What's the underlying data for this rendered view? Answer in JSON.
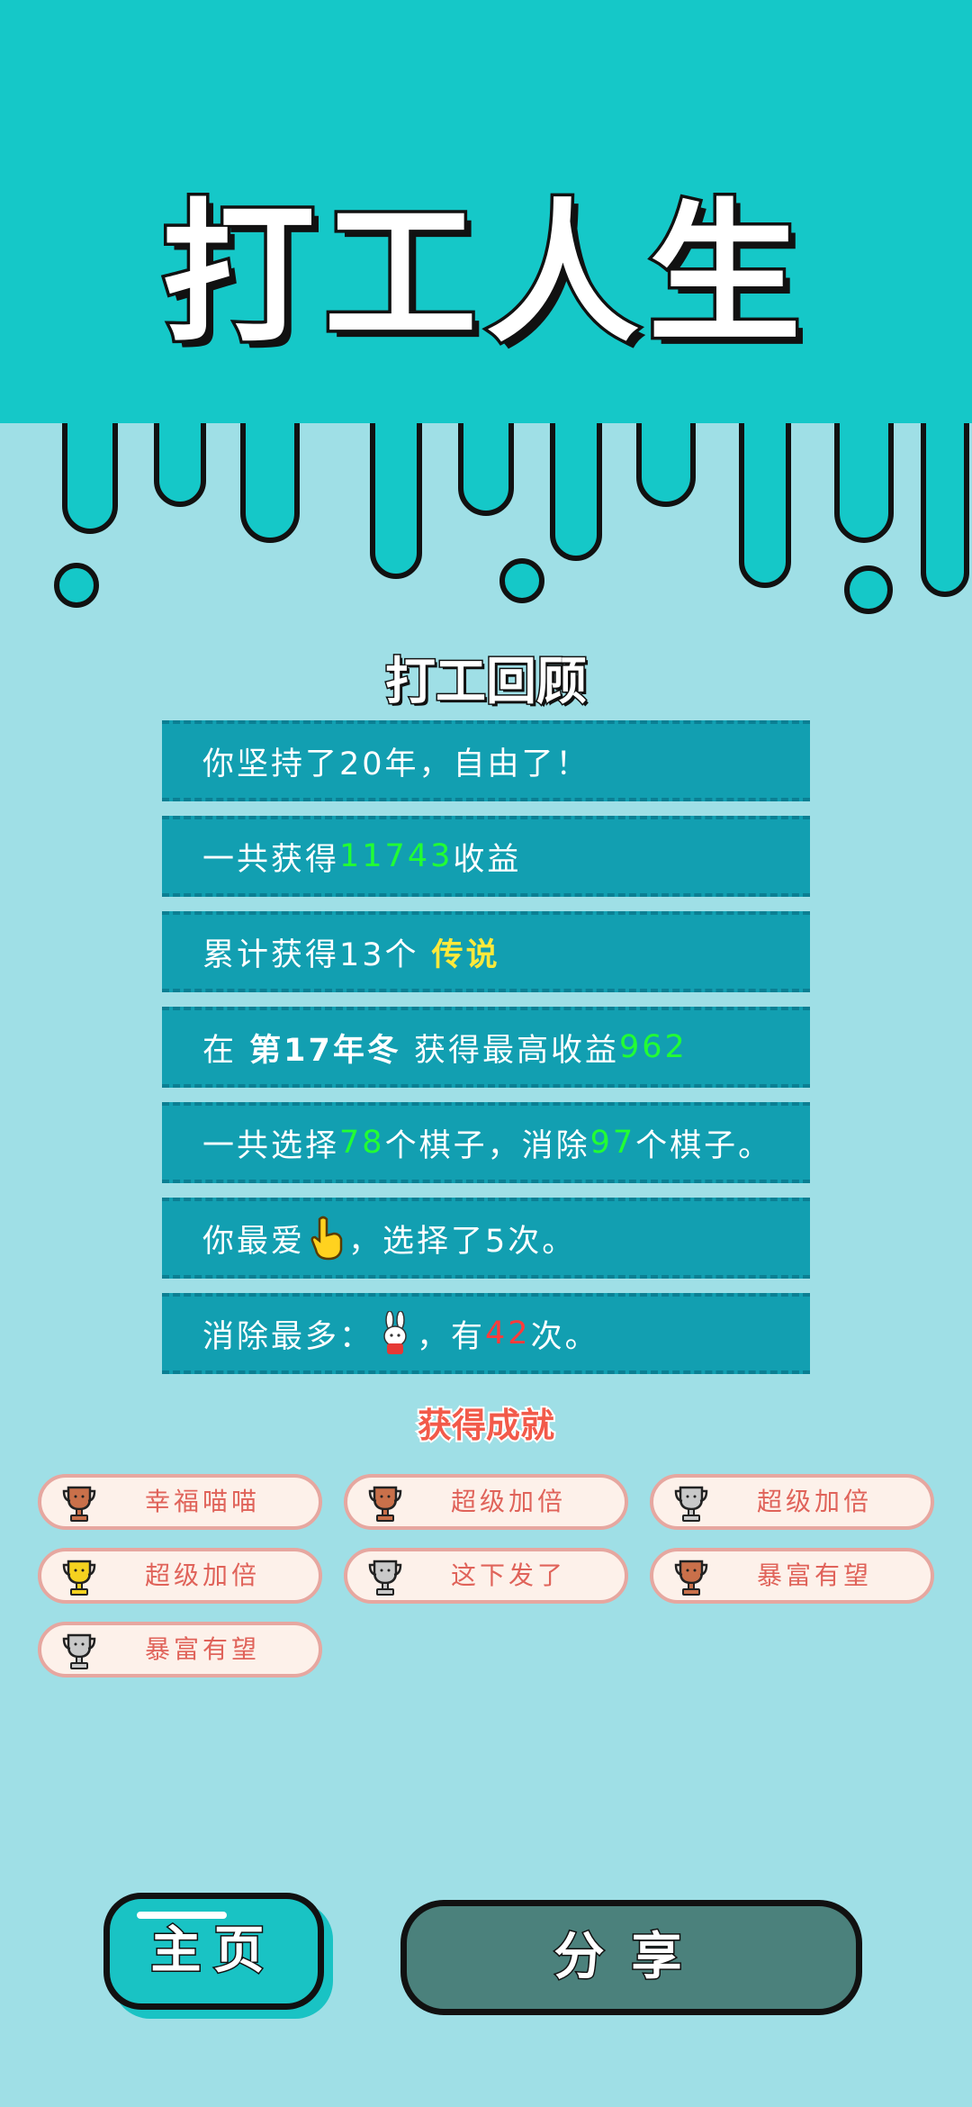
{
  "header": {
    "title": "打工人生"
  },
  "review": {
    "title": "打工回顾",
    "rows": [
      {
        "text": "你坚持了20年，自由了！"
      },
      {
        "prefix": "一共获得",
        "amount": "11743",
        "suffix": "收益"
      },
      {
        "prefix": "累计获得13个 ",
        "highlight": "传说"
      },
      {
        "prefix": "在 ",
        "period": "第17年冬",
        "middle": " 获得最高收益",
        "amount": "962"
      },
      {
        "part1": "一共选择",
        "chosen": "78",
        "part2": "个棋子，消除",
        "removed": "97",
        "part3": "个棋子。"
      },
      {
        "prefix": "你最爱",
        "icon": "pointing-hand-icon",
        "suffix": "，选择了5次。"
      },
      {
        "prefix": "消除最多：",
        "icon": "bunny-icon",
        "middle": "，有",
        "count": "42",
        "suffix": "次。"
      }
    ]
  },
  "achievements": {
    "title": "获得成就",
    "items": [
      {
        "label": "幸福喵喵",
        "trophy": "bronze",
        "color": "#c9704a"
      },
      {
        "label": "超级加倍",
        "trophy": "bronze",
        "color": "#c9704a"
      },
      {
        "label": "超级加倍",
        "trophy": "silver",
        "color": "#c9c9c9"
      },
      {
        "label": "超级加倍",
        "trophy": "gold",
        "color": "#f5d21f"
      },
      {
        "label": "这下发了",
        "trophy": "silver",
        "color": "#c9c9c9"
      },
      {
        "label": "暴富有望",
        "trophy": "bronze",
        "color": "#c9704a"
      },
      {
        "label": "暴富有望",
        "trophy": "silver",
        "color": "#c9c9c9"
      }
    ]
  },
  "buttons": {
    "home": "主页",
    "share": "分享"
  },
  "colors": {
    "teal": "#15c8c8",
    "background": "#9fdfe6",
    "row": "#129fb1",
    "share": "#4b817c"
  }
}
